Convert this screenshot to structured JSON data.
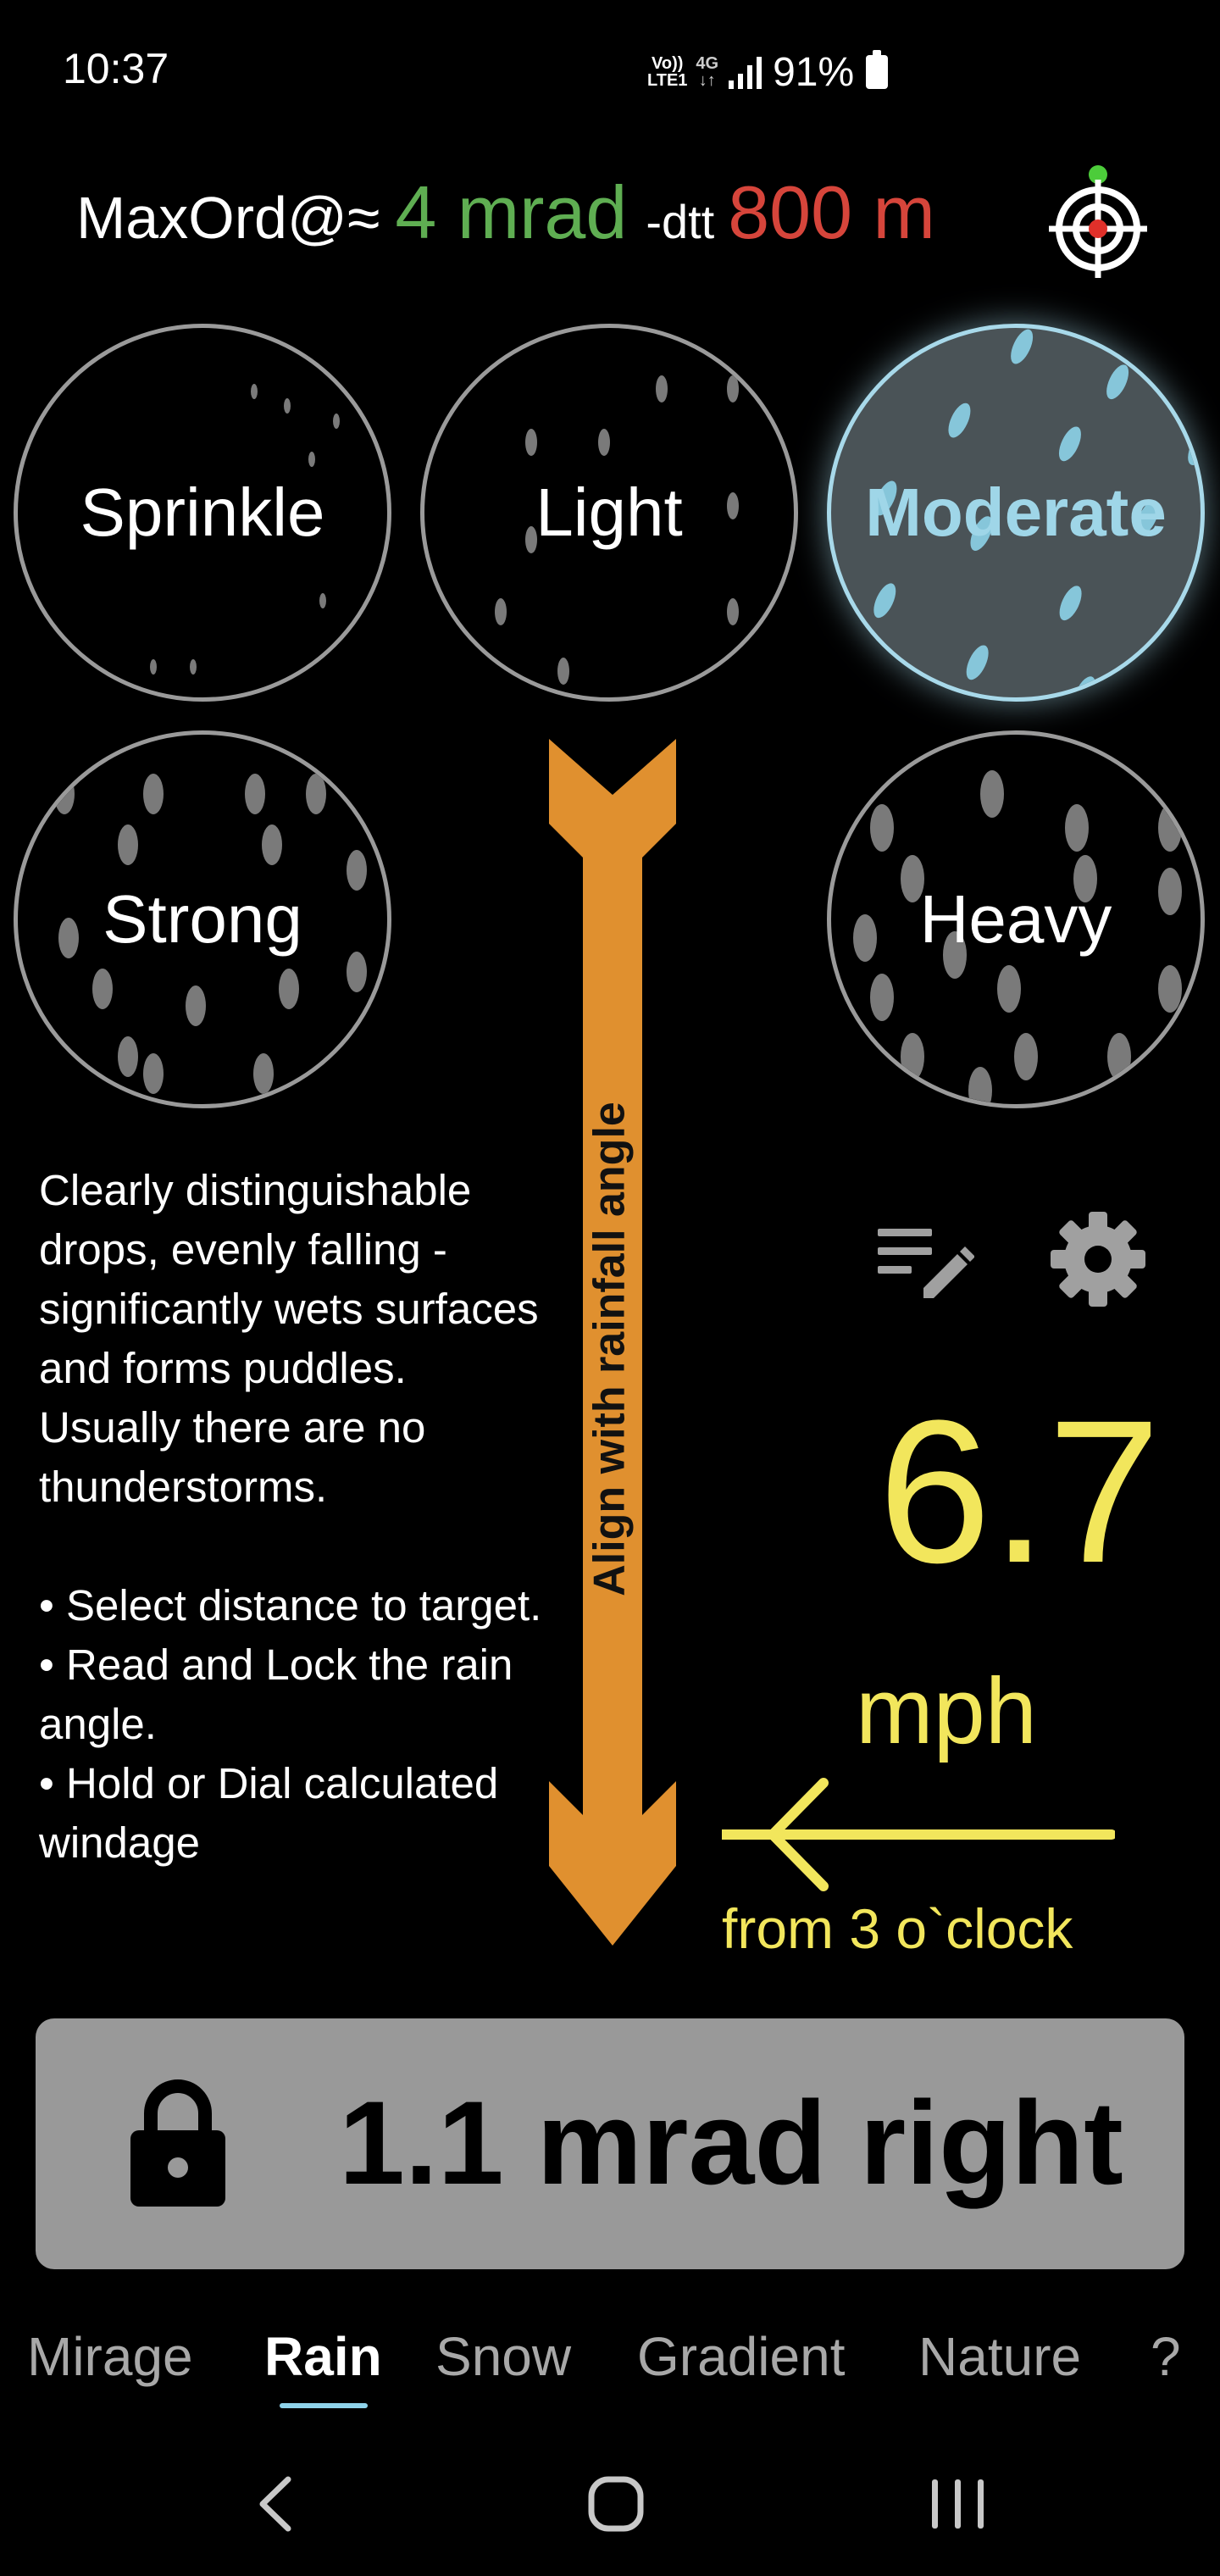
{
  "status_bar": {
    "time": "10:37",
    "volte_top": "Vo))",
    "volte_bottom": "LTE1",
    "network": "4G",
    "battery": "91%"
  },
  "header": {
    "label": "MaxOrd@≈",
    "mrad": "4 mrad",
    "dtt_label": "-dtt",
    "distance": "800 m",
    "colors": {
      "mrad": "#5fae52",
      "distance": "#d6453b"
    },
    "target_icon": "crosshair-target-icon"
  },
  "intensities": {
    "items": [
      {
        "label": "Sprinkle"
      },
      {
        "label": "Light"
      },
      {
        "label": "Moderate"
      },
      {
        "label": "Strong"
      },
      {
        "label": "Heavy"
      }
    ],
    "selected": "Moderate"
  },
  "arrow": {
    "label": "Align with rainfall angle",
    "color": "#e0902f"
  },
  "description": {
    "text": "Clearly distinguishable drops, evenly falling - significantly wets surfaces and forms puddles. Usually there are no thunderstorms.",
    "steps": [
      "• Select distance to target.",
      "• Read and Lock the rain angle.",
      "• Hold or Dial calculated windage"
    ]
  },
  "wind": {
    "speed": "6.7",
    "unit": "mph",
    "direction_text": "from 3 o`clock",
    "color": "#f2e65c"
  },
  "result": {
    "text": "1.1 mrad right"
  },
  "tabs": {
    "items": [
      "Mirage",
      "Rain",
      "Snow",
      "Gradient",
      "Nature",
      "?"
    ],
    "active": "Rain"
  },
  "icons": {
    "notes": "notes-edit-icon",
    "settings": "gear-icon",
    "lock": "lock-icon",
    "wind_arrow": "arrow-left-icon"
  }
}
